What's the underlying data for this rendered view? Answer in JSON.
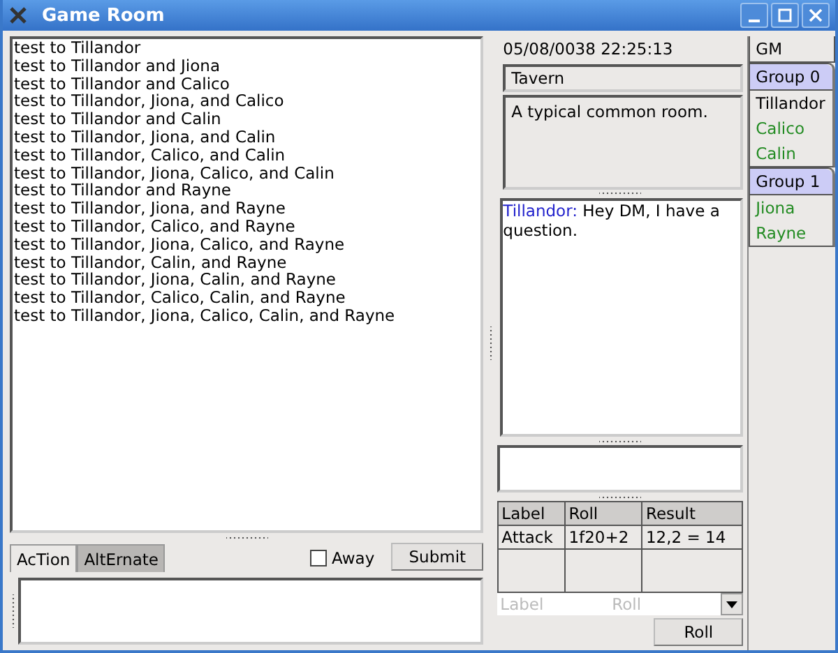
{
  "window": {
    "title": "Game Room"
  },
  "log": [
    "test to Tillandor",
    "test to Tillandor and Jiona",
    "test to Tillandor and Calico",
    "test to Tillandor, Jiona, and Calico",
    "test to Tillandor and Calin",
    "test to Tillandor, Jiona, and Calin",
    "test to Tillandor, Calico, and Calin",
    "test to Tillandor, Jiona, Calico, and Calin",
    "test to Tillandor and Rayne",
    "test to Tillandor, Jiona, and Rayne",
    "test to Tillandor, Calico, and Rayne",
    "test to Tillandor, Jiona, Calico, and Rayne",
    "test to Tillandor, Calin, and Rayne",
    "test to Tillandor, Jiona, Calin, and Rayne",
    "test to Tillandor, Calico, Calin, and Rayne",
    "test to Tillandor, Jiona, Calico, Calin, and Rayne"
  ],
  "tabs": [
    {
      "label": "AcTion",
      "selected": true
    },
    {
      "label": "AltErnate",
      "selected": false
    }
  ],
  "away": {
    "label": "Away",
    "checked": false
  },
  "submit_button": "Submit",
  "timestamp": "05/08/0038 22:25:13",
  "location": "Tavern",
  "description": "A typical common room.",
  "chat": [
    {
      "speaker": "Tillandor:",
      "text": "Hey DM, I have a question."
    }
  ],
  "rolls": {
    "columns": [
      "Label",
      "Roll",
      "Result"
    ],
    "rows": [
      [
        "Attack",
        "1f20+2",
        "12,2 = 14"
      ]
    ]
  },
  "roll_entry": {
    "label_placeholder": "Label",
    "roll_placeholder": "Roll"
  },
  "roll_button": "Roll",
  "players": [
    {
      "kind": "plain",
      "name": "GM"
    },
    {
      "kind": "group",
      "name": "Group 0",
      "members": [
        {
          "name": "Tillandor",
          "color": "#000000"
        },
        {
          "name": "Calico",
          "color": "#228b22"
        },
        {
          "name": "Calin",
          "color": "#228b22"
        }
      ]
    },
    {
      "kind": "group",
      "name": "Group 1",
      "members": [
        {
          "name": "Jiona",
          "color": "#228b22"
        },
        {
          "name": "Rayne",
          "color": "#228b22"
        }
      ]
    }
  ]
}
